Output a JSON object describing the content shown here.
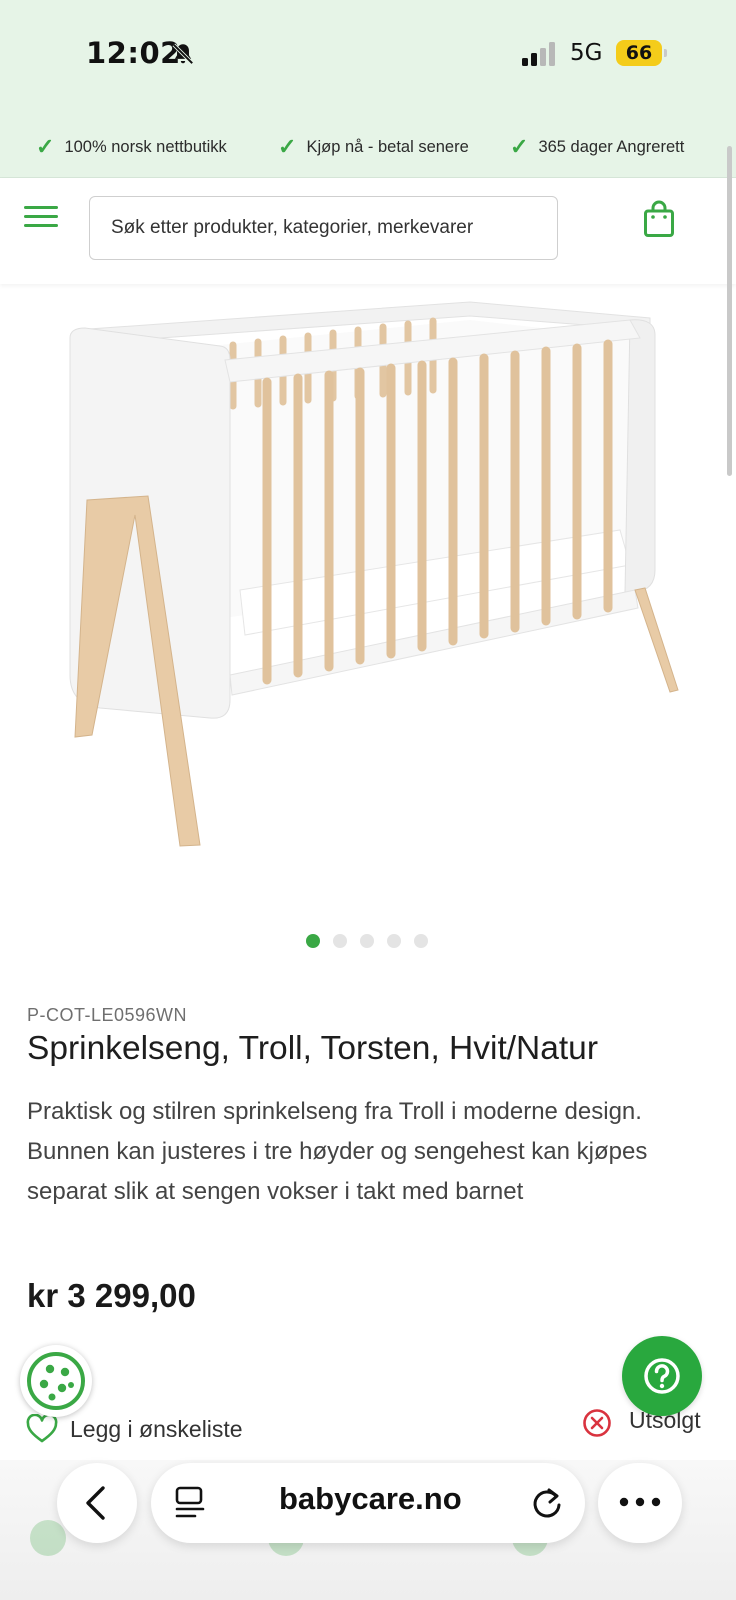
{
  "status_bar": {
    "time": "12:02",
    "network": "5G",
    "battery": "66"
  },
  "usp": [
    {
      "text": "100% norsk nettbutikk"
    },
    {
      "text": "Kjøp nå - betal senere"
    },
    {
      "text": "365 dager Angrerett"
    }
  ],
  "header": {
    "search_placeholder": "Søk etter produkter, kategorier, merkevarer"
  },
  "gallery": {
    "slide_count": 5,
    "active_slide": 1
  },
  "product": {
    "sku": "P-COT-LE0596WN",
    "title": "Sprinkelseng, Troll, Torsten, Hvit/Natur",
    "description": "Praktisk og stilren sprinkelseng fra Troll i moderne design. Bunnen kan justeres i tre høyder og sengehest kan kjøpes separat slik at sengen vokser i takt med barnet",
    "price": "kr 3 299,00",
    "wishlist_label": "Legg i ønskeliste",
    "stock_status": "Utsolgt"
  },
  "browser": {
    "url": "babycare.no"
  },
  "colors": {
    "accent": "#3aa845",
    "top_bar_bg": "#e6f4e7",
    "stock_red": "#d9333f",
    "battery": "#f4cc1a"
  },
  "icons": {
    "bell": "bell-slash-icon",
    "signal": "signal-icon",
    "menu": "hamburger-icon",
    "bag": "shopping-bag-icon",
    "cookie": "cookie-icon",
    "help": "question-icon",
    "wishlist": "heart-icon",
    "stock": "x-circle-icon",
    "back": "chevron-left-icon",
    "reader": "reader-icon",
    "reload": "reload-icon",
    "more": "ellipsis-icon"
  }
}
